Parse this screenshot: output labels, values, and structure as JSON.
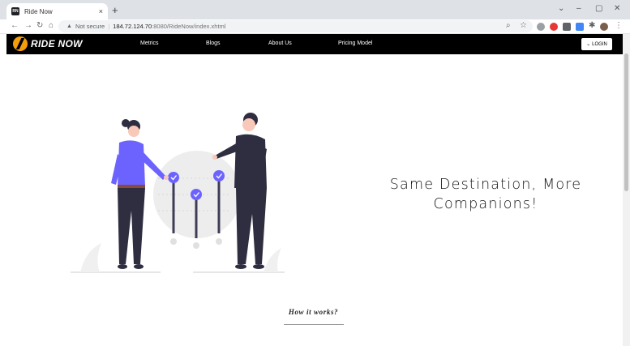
{
  "browser": {
    "tab_title": "Ride Now",
    "favicon_text": "RN",
    "tab_close": "×",
    "new_tab": "+",
    "url_warning": "Not secure",
    "url_host": "184.72.124.70",
    "url_path": ":8080/RideNow/index.xhtml"
  },
  "nav": {
    "logo_text": "RIDE NOW",
    "links": [
      "Metrics",
      "Blogs",
      "About Us",
      "Pricing Model"
    ],
    "login_label": "LOGIN"
  },
  "hero": {
    "tagline_line1": "Same Destination, More",
    "tagline_line2": "Companions!"
  },
  "how_it_works": {
    "title": "How it works?"
  },
  "colors": {
    "accent": "#6c63ff",
    "navbar": "#000000",
    "logo": "#f59e0b"
  }
}
